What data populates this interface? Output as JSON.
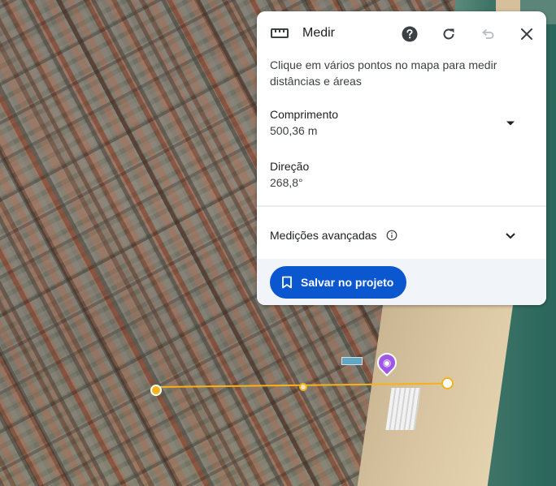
{
  "panel": {
    "title": "Medir",
    "instructions": "Clique em vários pontos no mapa para medir distâncias e áreas",
    "length_label": "Comprimento",
    "length_value": "500,36 m",
    "direction_label": "Direção",
    "direction_value": "268,8°",
    "advanced_label": "Medições avançadas",
    "save_label": "Salvar no projeto"
  },
  "icons": {
    "header": "ruler-icon",
    "help": "help-icon",
    "refresh": "refresh-icon",
    "undo": "undo-icon",
    "close": "close-icon",
    "unit_dropdown": "caret-down-icon",
    "advanced_info": "info-icon",
    "advanced_toggle": "chevron-down-icon",
    "save": "bookmark-icon",
    "poi": "photo-pin-icon"
  },
  "colors": {
    "accent": "#0b57d0",
    "measure_line": "#f6b21a",
    "poi": "#a056e6",
    "footer_bg": "#f1f4f9"
  }
}
